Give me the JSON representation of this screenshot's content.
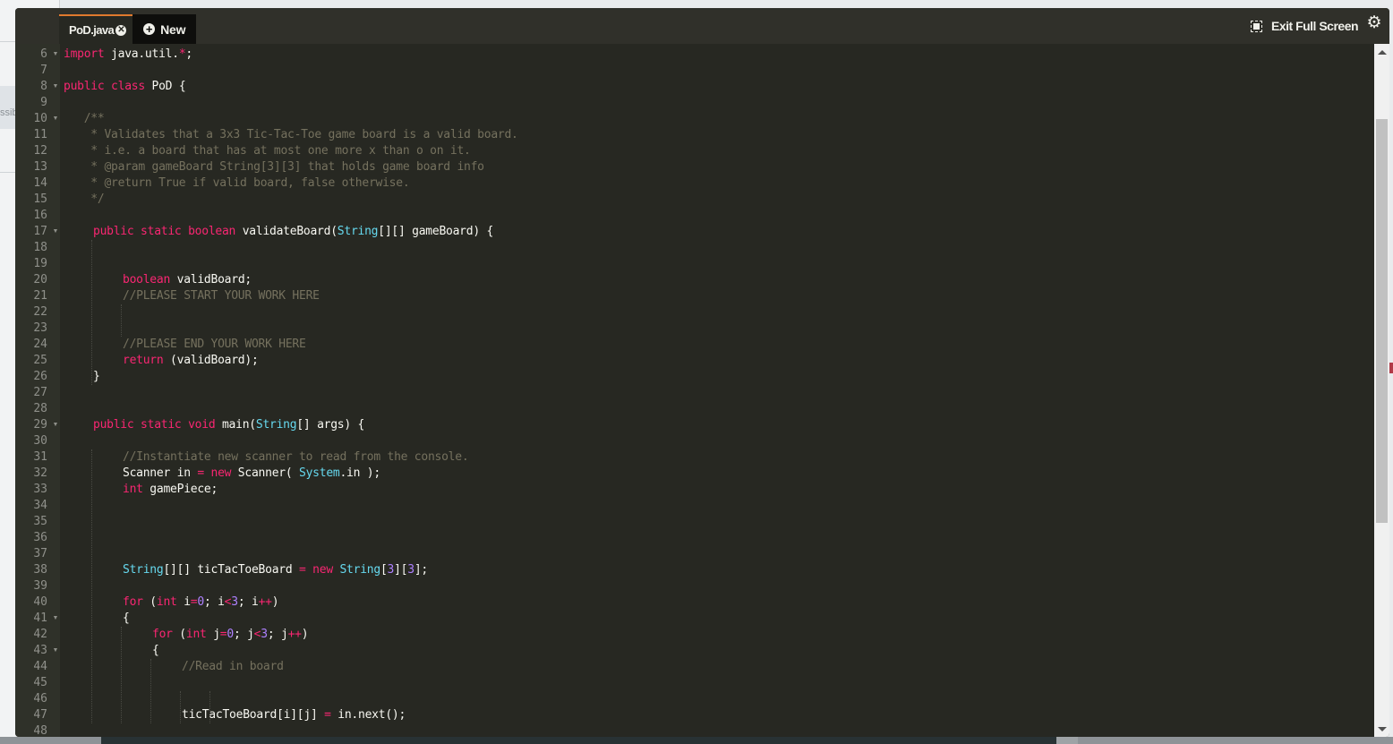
{
  "background": {
    "hint_text": "ssib"
  },
  "editor": {
    "tabs": [
      {
        "label": "PoD.java",
        "active": true,
        "close_icon": "close-circle-icon"
      },
      {
        "label": "New",
        "active": false,
        "icon": "plus-circle-icon"
      }
    ],
    "toolbar": {
      "exit_fullscreen_label": "Exit Full Screen",
      "exit_fullscreen_icon": "exit-fullscreen-icon",
      "settings_icon": "gear-icon"
    },
    "colors": {
      "background": "#272822",
      "keyword": "#f92672",
      "type": "#66d9ef",
      "comment": "#75715e",
      "number": "#ae81ff",
      "text": "#f8f8f2",
      "active_tab_accent": "#e07a2e"
    },
    "scroll": {
      "position_fraction": 0.09,
      "visible_fraction": 0.61
    },
    "lines": [
      {
        "n": "6",
        "fold": true,
        "indent": 0,
        "tokens": [
          [
            "kw",
            "import"
          ],
          [
            "tx",
            " java.util."
          ],
          [
            "op",
            "*"
          ],
          [
            "tx",
            ";"
          ]
        ]
      },
      {
        "n": "7",
        "fold": false,
        "indent": 0,
        "tokens": []
      },
      {
        "n": "8",
        "fold": true,
        "indent": 0,
        "tokens": [
          [
            "kw",
            "public"
          ],
          [
            "tx",
            " "
          ],
          [
            "kw",
            "class"
          ],
          [
            "tx",
            " PoD {"
          ]
        ]
      },
      {
        "n": "9",
        "fold": false,
        "indent": 0,
        "tokens": []
      },
      {
        "n": "10",
        "fold": true,
        "indent": 0,
        "tokens": [
          [
            "cm",
            "   /**"
          ]
        ]
      },
      {
        "n": "11",
        "fold": false,
        "indent": 0,
        "tokens": [
          [
            "cm",
            "    * Validates that a 3x3 Tic-Tac-Toe game board is a valid board."
          ]
        ]
      },
      {
        "n": "12",
        "fold": false,
        "indent": 0,
        "tokens": [
          [
            "cm",
            "    * i.e. a board that has at most one more x than o on it."
          ]
        ]
      },
      {
        "n": "13",
        "fold": false,
        "indent": 0,
        "tokens": [
          [
            "cm",
            "    * @param gameBoard String[3][3] that holds game board info"
          ]
        ]
      },
      {
        "n": "14",
        "fold": false,
        "indent": 0,
        "tokens": [
          [
            "cm",
            "    * @return True if valid board, false otherwise."
          ]
        ]
      },
      {
        "n": "15",
        "fold": false,
        "indent": 0,
        "tokens": [
          [
            "cm",
            "    */"
          ]
        ]
      },
      {
        "n": "16",
        "fold": false,
        "indent": 0,
        "tokens": []
      },
      {
        "n": "17",
        "fold": true,
        "indent": 1,
        "tokens": [
          [
            "kw",
            "public"
          ],
          [
            "tx",
            " "
          ],
          [
            "kw",
            "static"
          ],
          [
            "tx",
            " "
          ],
          [
            "kw",
            "boolean"
          ],
          [
            "tx",
            " validateBoard("
          ],
          [
            "ty",
            "String"
          ],
          [
            "tx",
            "[][] gameBoard) {"
          ]
        ]
      },
      {
        "n": "18",
        "fold": false,
        "indent": 0,
        "tokens": []
      },
      {
        "n": "19",
        "fold": false,
        "indent": 0,
        "tokens": []
      },
      {
        "n": "20",
        "fold": false,
        "indent": 2,
        "tokens": [
          [
            "kw",
            "boolean"
          ],
          [
            "tx",
            " validBoard;"
          ]
        ]
      },
      {
        "n": "21",
        "fold": false,
        "indent": 2,
        "tokens": [
          [
            "cm",
            "//PLEASE START YOUR WORK HERE"
          ]
        ]
      },
      {
        "n": "22",
        "fold": false,
        "indent": 0,
        "tokens": []
      },
      {
        "n": "23",
        "fold": false,
        "indent": 0,
        "tokens": []
      },
      {
        "n": "24",
        "fold": false,
        "indent": 2,
        "tokens": [
          [
            "cm",
            "//PLEASE END YOUR WORK HERE"
          ]
        ]
      },
      {
        "n": "25",
        "fold": false,
        "indent": 2,
        "tokens": [
          [
            "kw",
            "return"
          ],
          [
            "tx",
            " (validBoard);"
          ]
        ]
      },
      {
        "n": "26",
        "fold": false,
        "indent": 1,
        "tokens": [
          [
            "tx",
            "}"
          ]
        ]
      },
      {
        "n": "27",
        "fold": false,
        "indent": 0,
        "tokens": []
      },
      {
        "n": "28",
        "fold": false,
        "indent": 0,
        "tokens": []
      },
      {
        "n": "29",
        "fold": true,
        "indent": 1,
        "tokens": [
          [
            "kw",
            "public"
          ],
          [
            "tx",
            " "
          ],
          [
            "kw",
            "static"
          ],
          [
            "tx",
            " "
          ],
          [
            "kw",
            "void"
          ],
          [
            "tx",
            " main("
          ],
          [
            "ty",
            "String"
          ],
          [
            "tx",
            "[] args) {"
          ]
        ]
      },
      {
        "n": "30",
        "fold": false,
        "indent": 0,
        "tokens": []
      },
      {
        "n": "31",
        "fold": false,
        "indent": 2,
        "tokens": [
          [
            "cm",
            "//Instantiate new scanner to read from the console."
          ]
        ]
      },
      {
        "n": "32",
        "fold": false,
        "indent": 2,
        "tokens": [
          [
            "tx",
            "Scanner in "
          ],
          [
            "op",
            "="
          ],
          [
            "tx",
            " "
          ],
          [
            "kw",
            "new"
          ],
          [
            "tx",
            " Scanner( "
          ],
          [
            "ty",
            "System"
          ],
          [
            "tx",
            ".in );"
          ]
        ]
      },
      {
        "n": "33",
        "fold": false,
        "indent": 2,
        "tokens": [
          [
            "kw",
            "int"
          ],
          [
            "tx",
            " gamePiece;"
          ]
        ]
      },
      {
        "n": "34",
        "fold": false,
        "indent": 0,
        "tokens": []
      },
      {
        "n": "35",
        "fold": false,
        "indent": 0,
        "tokens": []
      },
      {
        "n": "36",
        "fold": false,
        "indent": 0,
        "tokens": []
      },
      {
        "n": "37",
        "fold": false,
        "indent": 0,
        "tokens": []
      },
      {
        "n": "38",
        "fold": false,
        "indent": 2,
        "tokens": [
          [
            "ty",
            "String"
          ],
          [
            "tx",
            "[][] ticTacToeBoard "
          ],
          [
            "op",
            "="
          ],
          [
            "tx",
            " "
          ],
          [
            "kw",
            "new"
          ],
          [
            "tx",
            " "
          ],
          [
            "ty",
            "String"
          ],
          [
            "tx",
            "["
          ],
          [
            "nu",
            "3"
          ],
          [
            "tx",
            "]["
          ],
          [
            "nu",
            "3"
          ],
          [
            "tx",
            "];"
          ]
        ]
      },
      {
        "n": "39",
        "fold": false,
        "indent": 0,
        "tokens": []
      },
      {
        "n": "40",
        "fold": false,
        "indent": 2,
        "tokens": [
          [
            "kw",
            "for"
          ],
          [
            "tx",
            " ("
          ],
          [
            "kw",
            "int"
          ],
          [
            "tx",
            " i"
          ],
          [
            "op",
            "="
          ],
          [
            "nu",
            "0"
          ],
          [
            "tx",
            "; i"
          ],
          [
            "op",
            "<"
          ],
          [
            "nu",
            "3"
          ],
          [
            "tx",
            "; i"
          ],
          [
            "op",
            "++"
          ],
          [
            "tx",
            ")"
          ]
        ]
      },
      {
        "n": "41",
        "fold": true,
        "indent": 2,
        "tokens": [
          [
            "tx",
            "{"
          ]
        ]
      },
      {
        "n": "42",
        "fold": false,
        "indent": 3,
        "tokens": [
          [
            "kw",
            "for"
          ],
          [
            "tx",
            " ("
          ],
          [
            "kw",
            "int"
          ],
          [
            "tx",
            " j"
          ],
          [
            "op",
            "="
          ],
          [
            "nu",
            "0"
          ],
          [
            "tx",
            "; j"
          ],
          [
            "op",
            "<"
          ],
          [
            "nu",
            "3"
          ],
          [
            "tx",
            "; j"
          ],
          [
            "op",
            "++"
          ],
          [
            "tx",
            ")"
          ]
        ]
      },
      {
        "n": "43",
        "fold": true,
        "indent": 3,
        "tokens": [
          [
            "tx",
            "{"
          ]
        ]
      },
      {
        "n": "44",
        "fold": false,
        "indent": 4,
        "tokens": [
          [
            "cm",
            "//Read in board"
          ]
        ]
      },
      {
        "n": "45",
        "fold": false,
        "indent": 0,
        "tokens": []
      },
      {
        "n": "46",
        "fold": false,
        "indent": 0,
        "tokens": []
      },
      {
        "n": "47",
        "fold": false,
        "indent": 4,
        "tokens": [
          [
            "tx",
            "ticTacToeBoard[i][j] "
          ],
          [
            "op",
            "="
          ],
          [
            "tx",
            " in.next();"
          ]
        ]
      },
      {
        "n": "48",
        "fold": false,
        "indent": 0,
        "tokens": []
      }
    ]
  }
}
